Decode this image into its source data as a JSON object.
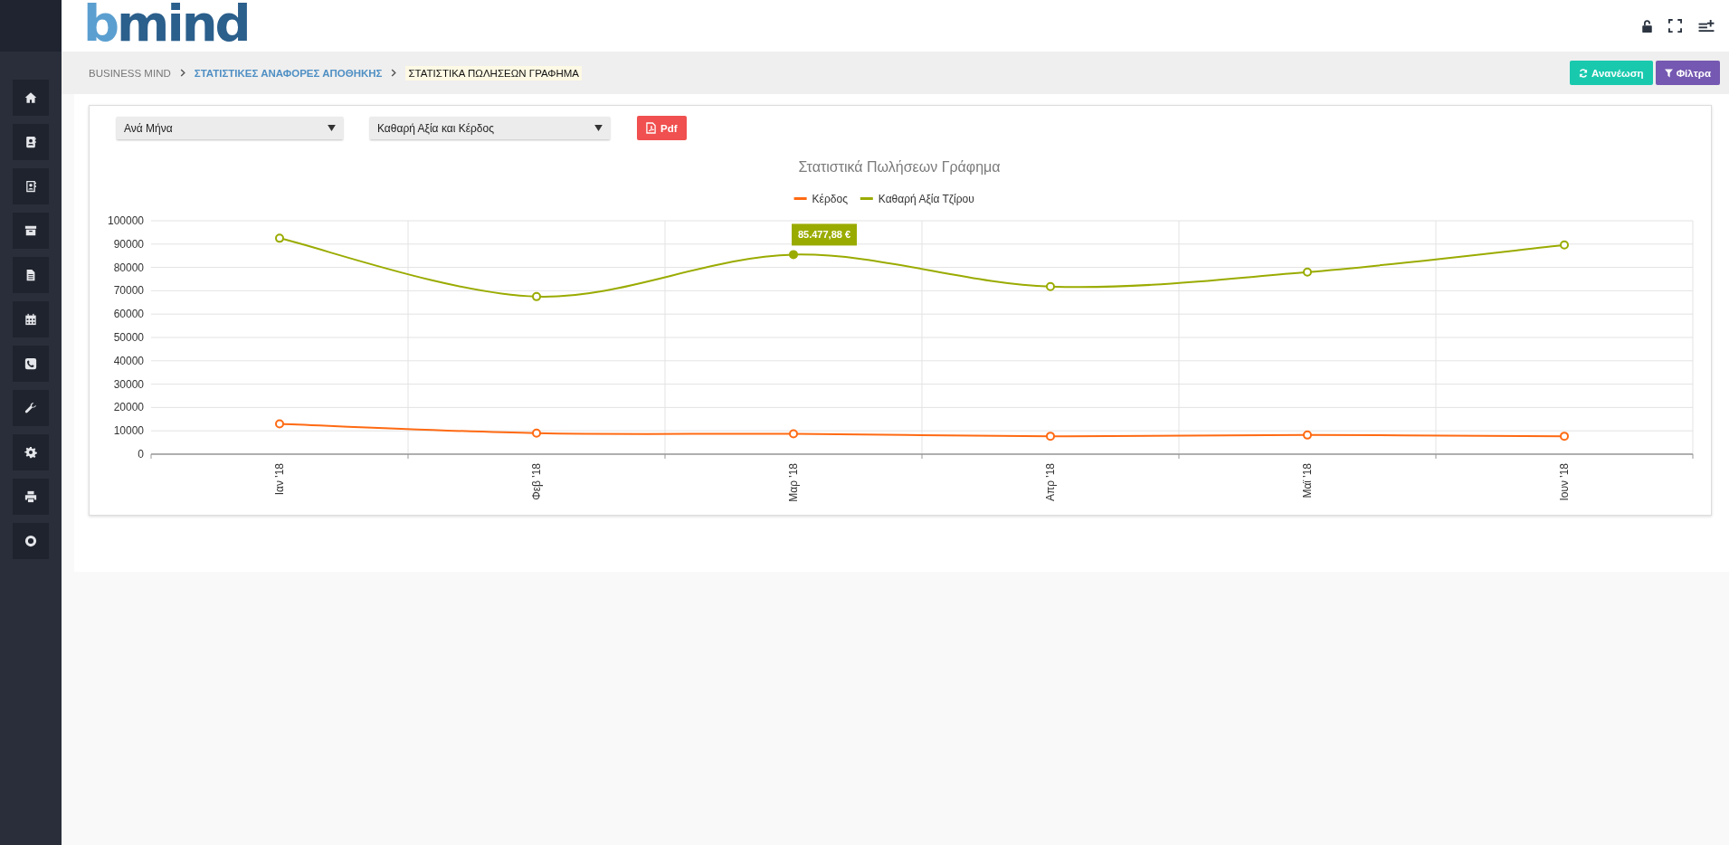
{
  "logo": {
    "text": "bmind"
  },
  "header_icons": [
    {
      "kind": "lock"
    },
    {
      "kind": "fullscreen"
    },
    {
      "kind": "list-add"
    }
  ],
  "sidebar": {
    "items": [
      {
        "kind": "home"
      },
      {
        "kind": "contact"
      },
      {
        "kind": "contact-outline"
      },
      {
        "kind": "archive"
      },
      {
        "kind": "document"
      },
      {
        "kind": "calendar"
      },
      {
        "kind": "phone"
      },
      {
        "kind": "wrench"
      },
      {
        "kind": "gear"
      },
      {
        "kind": "printer"
      },
      {
        "kind": "lifebuoy"
      }
    ]
  },
  "breadcrumb": [
    {
      "label": "BUSINESS MIND",
      "kind": "root"
    },
    {
      "label": "ΣΤΑΤΙΣΤΙΚΕΣ ΑΝΑΦΟΡΕΣ ΑΠΟΘΗΚΗΣ",
      "kind": "link"
    },
    {
      "label": "ΣΤΑΤΙΣΤΙΚΑ ΠΩΛΗΣΕΩΝ ΓΡΑΦΗΜΑ",
      "kind": "current"
    }
  ],
  "actions": [
    {
      "label": "Ανανέωση",
      "kind": "refresh"
    },
    {
      "label": "Φίλτρα",
      "kind": "filter"
    }
  ],
  "filters": [
    {
      "value": "Ανά Μήνα"
    },
    {
      "value": "Καθαρή Αξία και Κέρδος"
    }
  ],
  "export_button": {
    "label": "Pdf"
  },
  "chart": {
    "chart_data": {
      "type": "line",
      "title": "Στατιστικά Πωλήσεων Γράφημα",
      "categories": [
        "Ιαν '18",
        "Φεβ '18",
        "Μαρ '18",
        "Απρ '18",
        "Μαϊ '18",
        "Ιουν '18"
      ],
      "series": [
        {
          "name": "Κέρδος",
          "color": "#ff6a13",
          "marker": "circle",
          "values": [
            13000,
            9000,
            8700,
            7700,
            8200,
            7700
          ]
        },
        {
          "name": "Καθαρή Αξία Τζίρου",
          "color": "#9aab00",
          "marker": "circle",
          "values": [
            92500,
            67500,
            85500,
            71800,
            78000,
            89600
          ]
        }
      ],
      "grid": true,
      "legend": true,
      "ylim": [
        0,
        100000
      ],
      "yticks": [
        0,
        10000,
        20000,
        30000,
        40000,
        50000,
        60000,
        70000,
        80000,
        90000,
        100000
      ],
      "annotations": [
        {
          "x": "Μαρ '18",
          "y": 85500,
          "text": "85.477,88 €"
        }
      ]
    }
  }
}
